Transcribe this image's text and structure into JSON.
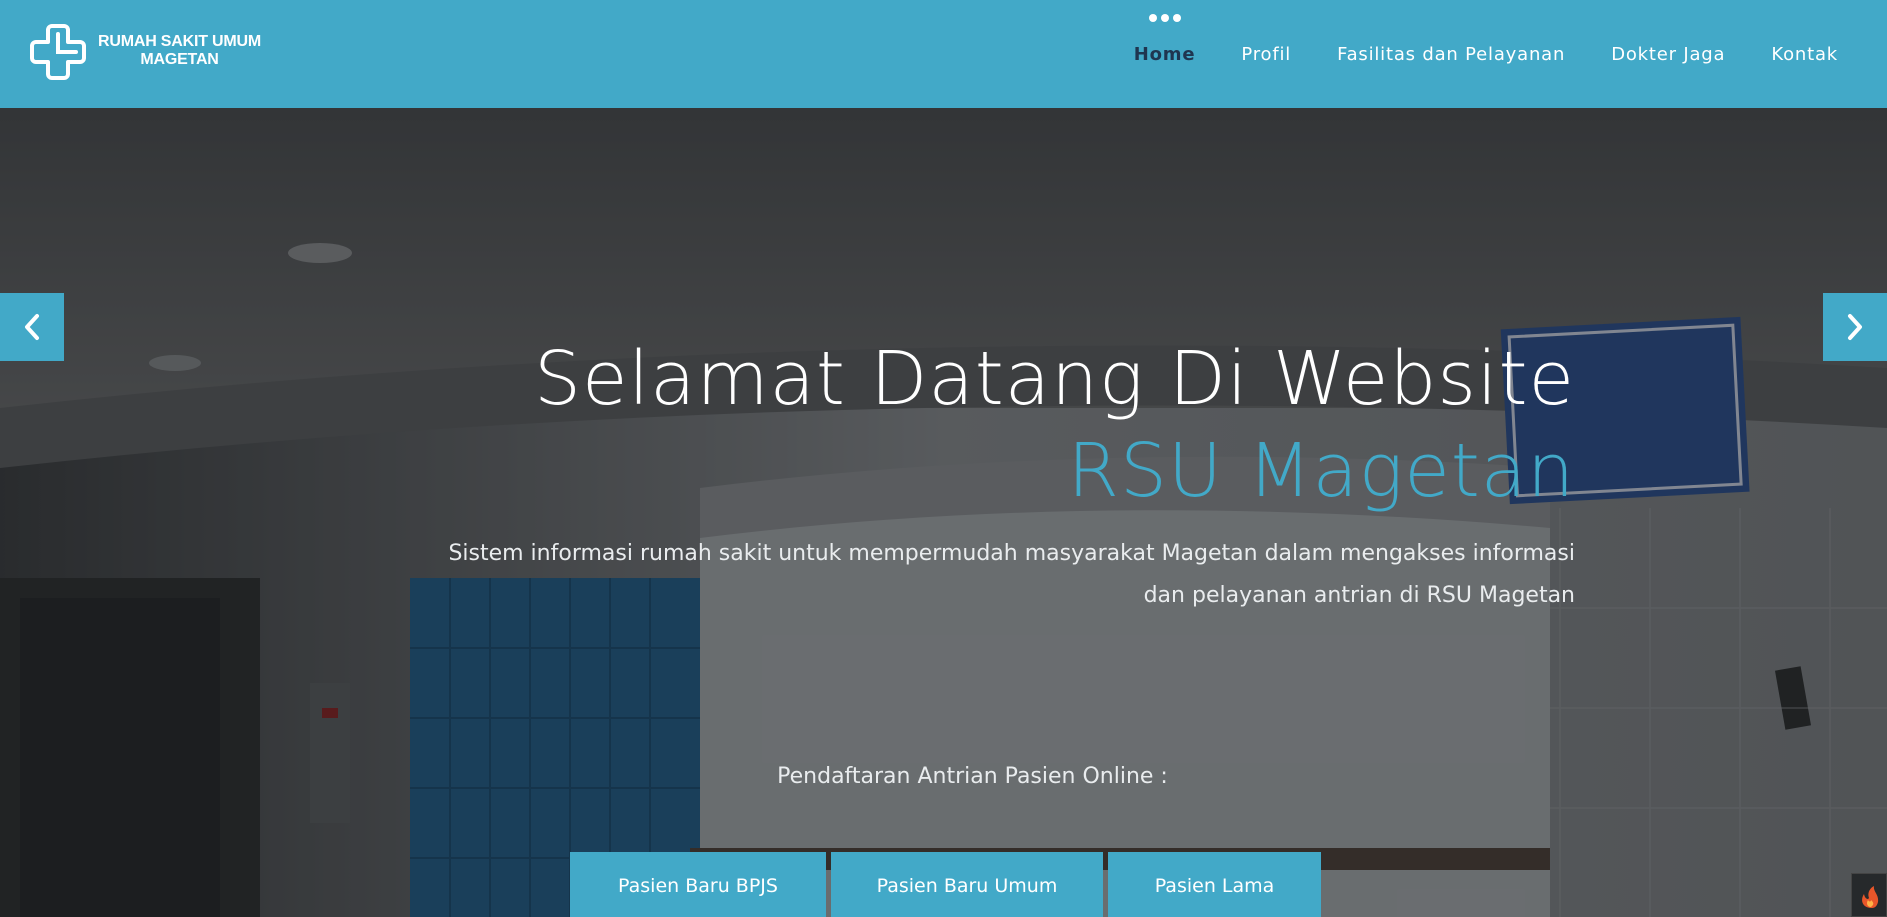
{
  "brand": {
    "logo_line1": "RUMAH SAKIT UMUM",
    "logo_line2": "MAGETAN",
    "accent_color": "#42a9c8"
  },
  "nav": {
    "items": [
      {
        "label": "Home",
        "active": true
      },
      {
        "label": "Profil"
      },
      {
        "label": "Fasilitas dan Pelayanan"
      },
      {
        "label": "Dokter Jaga"
      },
      {
        "label": "Kontak"
      }
    ]
  },
  "hero": {
    "title_main": "Selamat Datang Di Website ",
    "title_highlight": "RSU Magetan",
    "subtitle": "Sistem informasi rumah sakit untuk mempermudah masyarakat Magetan dalam mengakses informasi dan pelayanan antrian di RSU Magetan",
    "cta_label": "Pendaftaran Antrian Pasien Online :",
    "buttons": [
      {
        "label": "Pasien Baru BPJS"
      },
      {
        "label": "Pasien Baru Umum"
      },
      {
        "label": "Pasien Lama"
      }
    ],
    "prev_icon": "chevron-left-icon",
    "next_icon": "chevron-right-icon"
  }
}
